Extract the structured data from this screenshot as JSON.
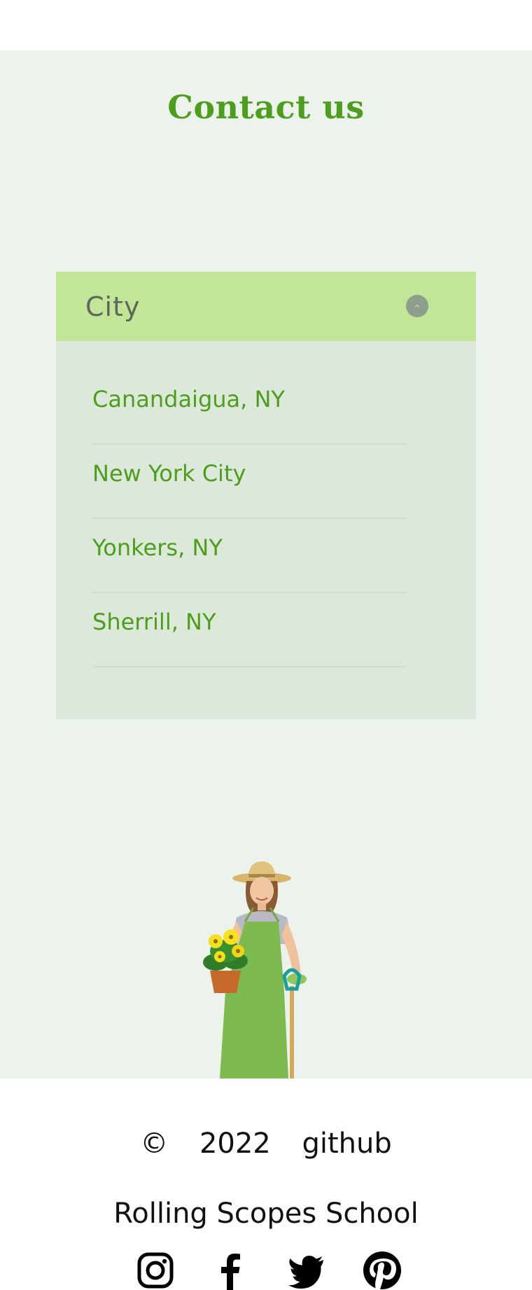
{
  "contacts": {
    "title": "Contact us",
    "accordion": {
      "label": "City",
      "expanded": true,
      "toggle_icon": "chevron-up-icon",
      "items": [
        {
          "label": "Canandaigua, NY"
        },
        {
          "label": "New York City"
        },
        {
          "label": "Yonkers, NY"
        },
        {
          "label": "Sherrill, NY"
        }
      ]
    },
    "image": "gardener-woman-image"
  },
  "footer": {
    "copyright_symbol": "©",
    "year": "2022",
    "github_link": "github",
    "school": "Rolling Scopes School",
    "socials": [
      {
        "icon": "instagram-icon"
      },
      {
        "icon": "facebook-icon"
      },
      {
        "icon": "twitter-icon"
      },
      {
        "icon": "pinterest-icon"
      }
    ]
  },
  "colors": {
    "accent_green": "#4e9e1e",
    "section_bg": "#ecf2ec",
    "accordion_header": "#c1e698",
    "accordion_body": "#dce9da"
  }
}
